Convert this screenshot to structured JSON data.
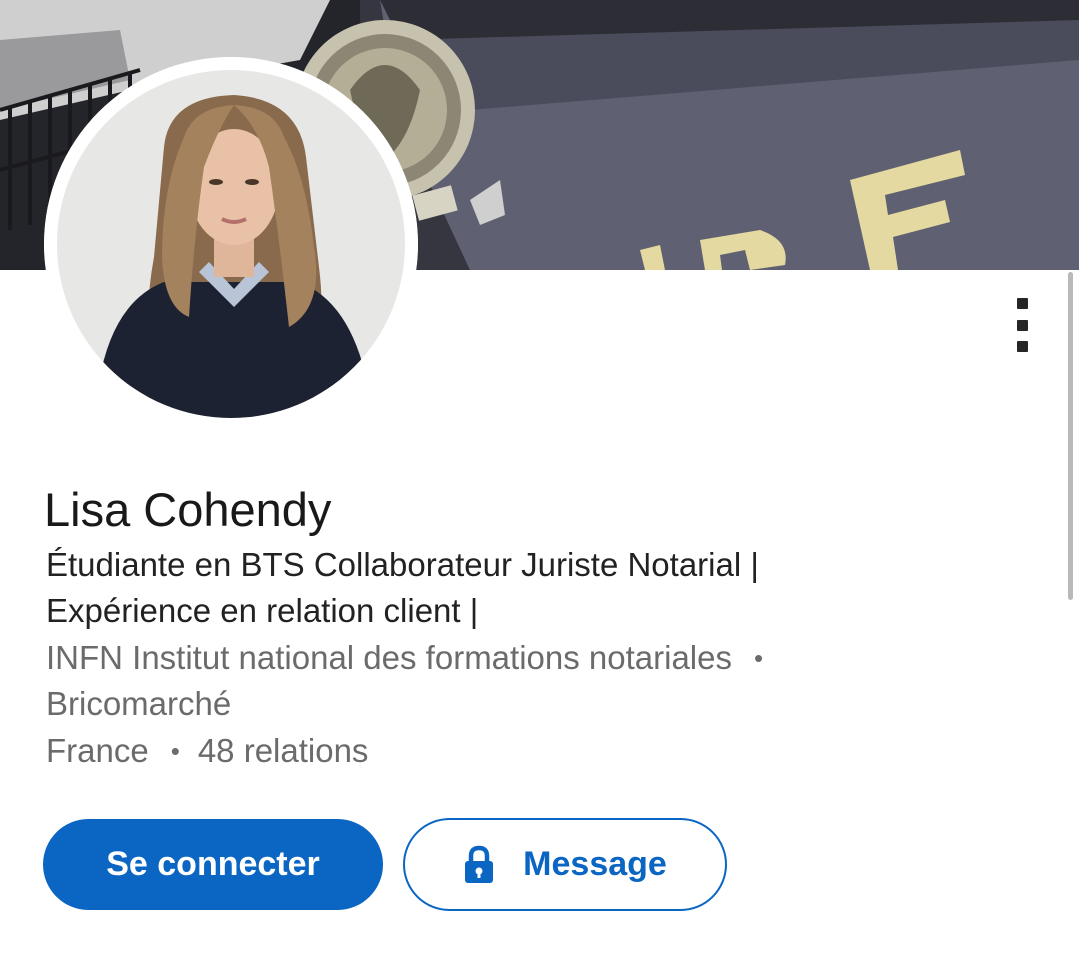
{
  "profile": {
    "name": "Lisa Cohendy",
    "headline_line1": "Étudiante en BTS Collaborateur Juriste Notarial |",
    "headline_line2": "Expérience en relation client |",
    "education": "INFN Institut national des formations notariales",
    "separator": "•",
    "employer": "Bricomarché",
    "location": "France",
    "connections": "48 relations"
  },
  "actions": {
    "connect_label": "Se connecter",
    "message_label": "Message",
    "message_icon": "lock-icon",
    "more_icon": "more-vertical-icon"
  },
  "colors": {
    "accent": "#0a66c2",
    "text_primary": "#191919",
    "text_secondary": "#6b6b6b"
  }
}
